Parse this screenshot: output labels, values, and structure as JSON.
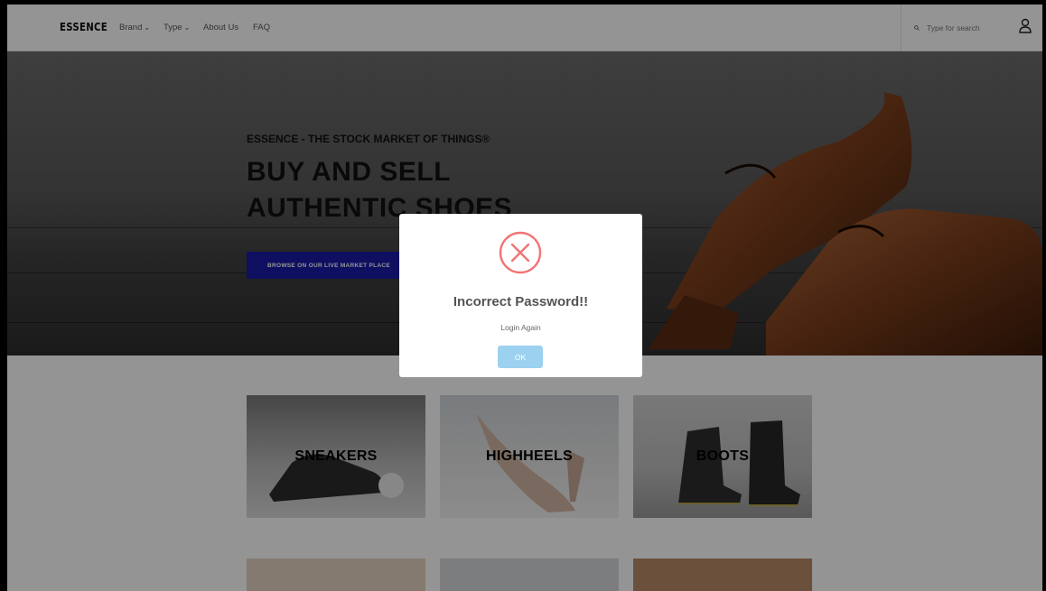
{
  "navbar": {
    "logo": "ESSENCE",
    "items": [
      {
        "label": "Brand",
        "has_dropdown": true
      },
      {
        "label": "Type",
        "has_dropdown": true
      },
      {
        "label": "About Us",
        "has_dropdown": false
      },
      {
        "label": "FAQ",
        "has_dropdown": false
      }
    ],
    "search_placeholder": "Type for search",
    "search_icon": "search-icon",
    "user_icon": "user-icon"
  },
  "hero": {
    "kicker": "ESSENCE - THE STOCK MARKET OF THINGS®",
    "title_line1": "BUY AND SELL",
    "title_line2": "AUTHENTIC SHOES",
    "cta_label": "BROWSE ON OUR LIVE MARKET PLACE"
  },
  "categories": [
    {
      "label": "SNEAKERS"
    },
    {
      "label": "HIGHHEELS"
    },
    {
      "label": "BOOTS"
    }
  ],
  "modal": {
    "icon": "error-x-icon",
    "title": "Incorrect Password!!",
    "text": "Login Again",
    "ok_label": "OK"
  },
  "colors": {
    "cta_background": "#1b1ba8",
    "error_red": "#f27474",
    "ok_button": "#9dd1f0",
    "overlay": "rgba(0,0,0,0.42)"
  }
}
